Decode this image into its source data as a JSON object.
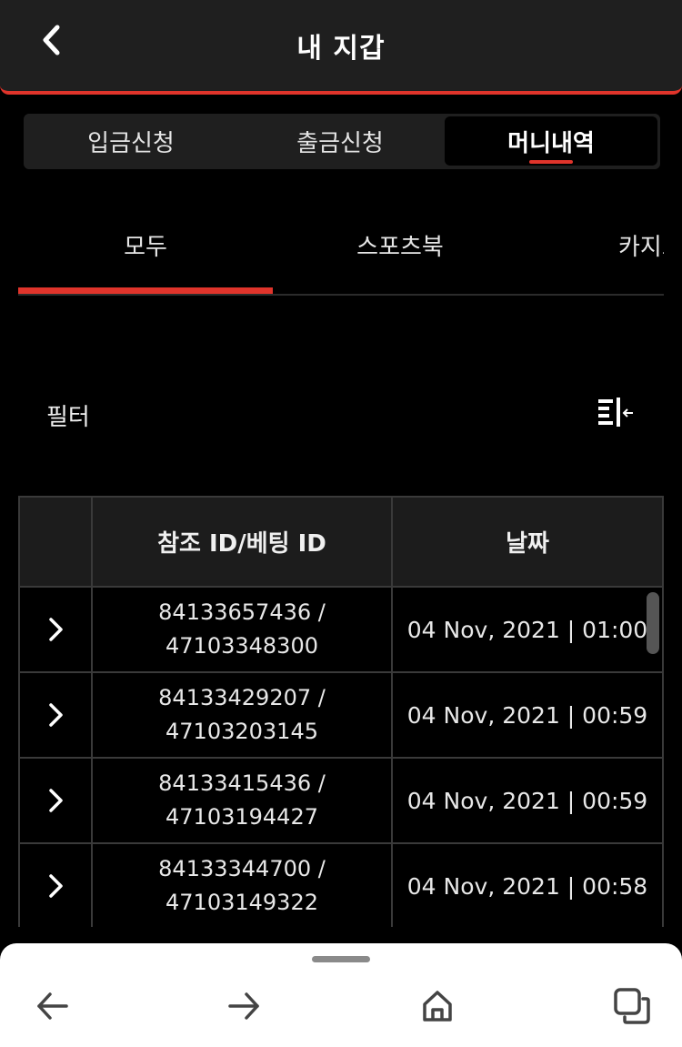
{
  "header": {
    "title": "내 지갑",
    "back_icon": "chevron-left-icon"
  },
  "tabs": [
    "입금신청",
    "출금신청",
    "머니내역"
  ],
  "active_tab": 2,
  "subtabs": [
    "모두",
    "스포츠북",
    "카지노"
  ],
  "active_subtab": 0,
  "filter": {
    "label": "필터",
    "icon": "filter-collapse-icon"
  },
  "table": {
    "headers": [
      "",
      "참조 ID/베팅 ID",
      "날짜"
    ],
    "rows": [
      {
        "ref_id": "84133657436 /",
        "bet_id": "47103348300",
        "date": "04 Nov, 2021 | 01:00"
      },
      {
        "ref_id": "84133429207 /",
        "bet_id": "47103203145",
        "date": "04 Nov, 2021 | 00:59"
      },
      {
        "ref_id": "84133415436 /",
        "bet_id": "47103194427",
        "date": "04 Nov, 2021 | 00:59"
      },
      {
        "ref_id": "84133344700 /",
        "bet_id": "47103149322",
        "date": "04 Nov, 2021 | 00:58"
      }
    ]
  },
  "browser_nav": {
    "back_icon": "arrow-left-icon",
    "forward_icon": "arrow-right-icon",
    "home_icon": "home-icon",
    "tabs_icon": "tabs-icon"
  },
  "colors": {
    "accent": "#e0342b",
    "background": "#000000",
    "surface": "#1f1f1f",
    "grid": "#3a3a3a"
  }
}
